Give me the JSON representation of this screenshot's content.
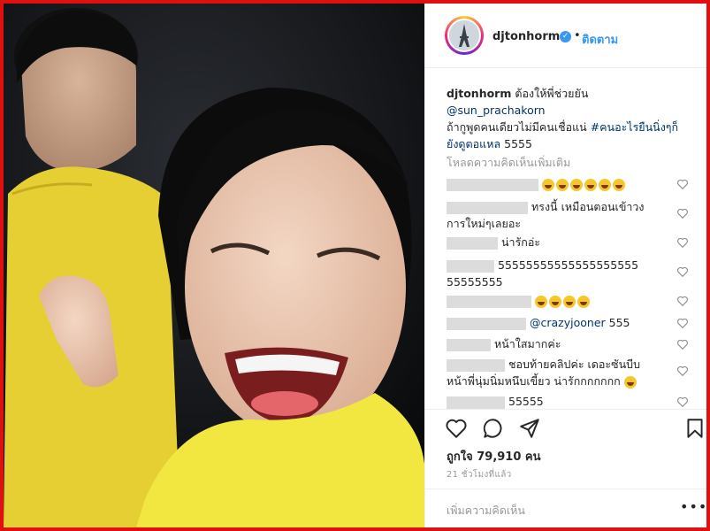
{
  "header": {
    "username": "djtonhorm",
    "separator": "•",
    "follow_label": "ติดตาม",
    "avatar_icon": "eiffel-tower-avatar"
  },
  "caption": {
    "username": "djtonhorm",
    "line1": "ต้องให้พี่ช่วยยัน",
    "mention": "@sun_prachakorn",
    "line2": "ถ้ากูพูดคนเดียวไม่มีคนเชื่อแน่",
    "hashtag": "#คนอะไรยืนนิ่งๆก็ยังดูตอแหล",
    "line3": "5555"
  },
  "load_more_label": "โหลดความคิดเห็นเพิ่มเติม",
  "comments": [
    {
      "text": "",
      "emoji_count": 6
    },
    {
      "text": "ทรงนี้ เหมือนตอนเข้าวงการใหม่ๆเลยอะ",
      "emoji_count": 0
    },
    {
      "text": "น่ารักอ่ะ",
      "emoji_count": 0
    },
    {
      "text": "5555555555555555555555555555",
      "emoji_count": 0
    },
    {
      "text": "",
      "emoji_count": 4
    },
    {
      "mention": "@crazyjooner",
      "text": "555",
      "emoji_count": 0
    },
    {
      "text": "หน้าใสมากค่ะ",
      "emoji_count": 0
    },
    {
      "text": "ชอบท้ายคลิปค่ะ เดอะซันบีบหน้าพี่นุ่มนิ่มหนึบเขี้ยว น่ารักกกกกกก",
      "emoji_count": 1
    },
    {
      "text": "55555",
      "emoji_count": 0
    }
  ],
  "actions": {
    "like_icon": "heart-icon",
    "comment_icon": "comment-icon",
    "share_icon": "share-icon",
    "save_icon": "bookmark-icon"
  },
  "likes_label": "ถูกใจ 79,910 คน",
  "time_label": "21 ชั่วโมงที่แล้ว",
  "add_comment": {
    "placeholder": "เพิ่มความคิดเห็น",
    "more_label": "•••"
  },
  "colors": {
    "frame_border": "#e01010",
    "link": "#3897f0",
    "shirt": "#f2e640"
  }
}
